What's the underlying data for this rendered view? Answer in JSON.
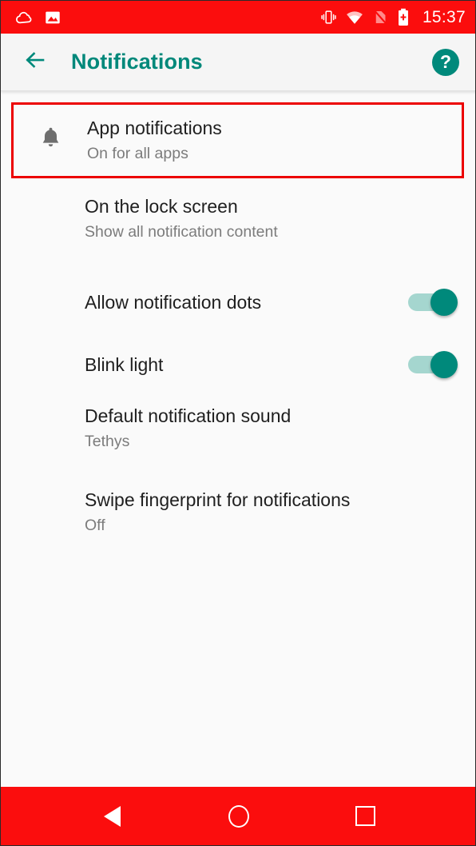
{
  "status_bar": {
    "time": "15:37",
    "left_icons": [
      {
        "name": "weather-cloud-icon"
      },
      {
        "name": "screenshot-image-icon"
      }
    ],
    "right_icons": [
      {
        "name": "vibrate-mode-icon"
      },
      {
        "name": "wifi-icon"
      },
      {
        "name": "no-sim-card-icon"
      },
      {
        "name": "battery-charging-icon"
      }
    ],
    "background_color": "#fb0d0d"
  },
  "toolbar": {
    "back_label": "back-arrow",
    "title": "Notifications",
    "help_label": "?",
    "accent_color": "#00897b",
    "background_color": "#f5f5f5"
  },
  "settings": {
    "highlight_color": "#ec0000",
    "items": [
      {
        "id": "app-notifications",
        "icon": "bell-icon",
        "title": "App notifications",
        "subtitle": "On for all apps",
        "highlighted": true,
        "control": "none"
      },
      {
        "id": "on-the-lock-screen",
        "title": "On the lock screen",
        "subtitle": "Show all notification content",
        "highlighted": false,
        "control": "none"
      },
      {
        "id": "allow-notification-dots",
        "title": "Allow notification dots",
        "subtitle": "",
        "highlighted": false,
        "control": "switch",
        "switch_state": "on"
      },
      {
        "id": "blink-light",
        "title": "Blink light",
        "subtitle": "",
        "highlighted": false,
        "control": "switch",
        "switch_state": "on"
      },
      {
        "id": "default-notification-sound",
        "title": "Default notification sound",
        "subtitle": "Tethys",
        "highlighted": false,
        "control": "none"
      },
      {
        "id": "swipe-fingerprint-for-notifications",
        "title": "Swipe fingerprint for notifications",
        "subtitle": "Off",
        "highlighted": false,
        "control": "none"
      }
    ]
  },
  "nav_bar": {
    "background_color": "#fb0d0d",
    "buttons": [
      {
        "name": "nav-back-button"
      },
      {
        "name": "nav-home-button"
      },
      {
        "name": "nav-recents-button"
      }
    ]
  }
}
